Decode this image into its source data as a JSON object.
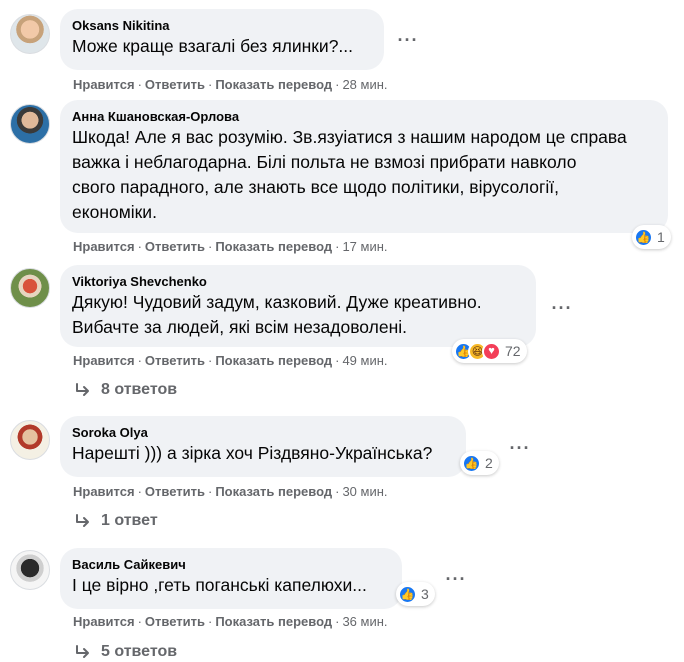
{
  "comments": [
    {
      "author": "Oksans Nikitina",
      "text": [
        "Може краще взагалі без ялинки?..."
      ],
      "actions": {
        "like": "Нравится",
        "reply": "Ответить",
        "translate": "Показать перевод",
        "time": "28 мин."
      }
    },
    {
      "author": "Анна Кшановская-Орлова",
      "text": [
        "Шкода! Але я вас розумію. Зв.язуiатися з нашим народом це справа",
        "важка і неблагодарна. Білі польта не взмозі прибрати навколо",
        "свого парадного, але знають все щодо політики, вірусології,",
        "економіки."
      ],
      "actions": {
        "like": "Нравится",
        "reply": "Ответить",
        "translate": "Показать перевод",
        "time": "17 мин."
      },
      "reactions": {
        "count": "1",
        "icons": [
          "like-icon"
        ]
      }
    },
    {
      "author": "Viktoriya Shevchenko",
      "text": [
        "Дякую!   Чудовий задум, казковий. Дуже креативно.",
        "Вибачте за людей, які всім незадоволені."
      ],
      "actions": {
        "like": "Нравится",
        "reply": "Ответить",
        "translate": "Показать перевод",
        "time": "49 мин."
      },
      "reactions": {
        "count": "72",
        "icons": [
          "like-icon",
          "haha-icon",
          "love-icon"
        ]
      },
      "replies": "8 ответов"
    },
    {
      "author": "Soroka Olya",
      "text": [
        "Нарешті ))) а зірка хоч Різдвяно-Українська?"
      ],
      "actions": {
        "like": "Нравится",
        "reply": "Ответить",
        "translate": "Показать перевод",
        "time": "30 мин."
      },
      "reactions": {
        "count": "2",
        "icons": [
          "like-icon"
        ]
      },
      "replies": "1 ответ"
    },
    {
      "author": "Василь Сайкевич",
      "text": [
        "І це вірно ,геть поганські капелюхи..."
      ],
      "actions": {
        "like": "Нравится",
        "reply": "Ответить",
        "translate": "Показать перевод",
        "time": "36 мин."
      },
      "reactions": {
        "count": "3",
        "icons": [
          "like-icon"
        ]
      },
      "replies": "5 ответов"
    }
  ],
  "colors": {
    "bubble": "#f0f2f5",
    "secondary_text": "#65676b",
    "like_blue": "#1877f2",
    "haha_yellow": "#f7b928",
    "love_red": "#f33e58"
  }
}
